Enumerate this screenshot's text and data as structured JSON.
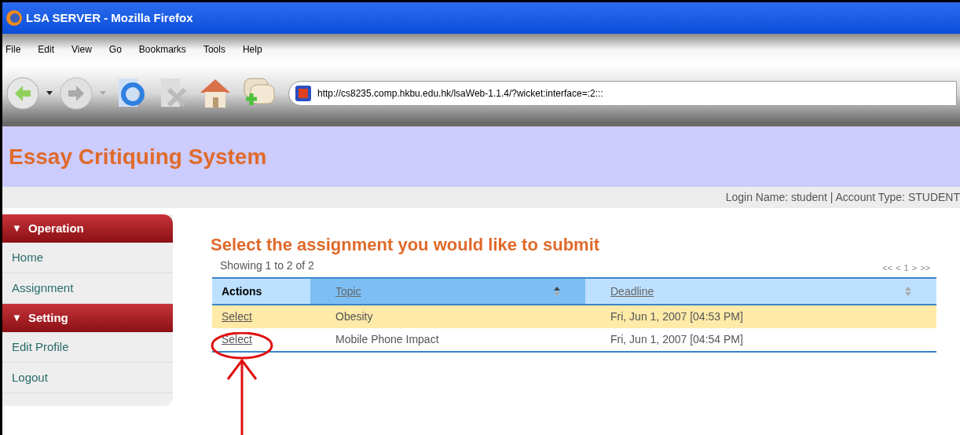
{
  "window": {
    "title": "LSA SERVER - Mozilla Firefox"
  },
  "menu": [
    "File",
    "Edit",
    "View",
    "Go",
    "Bookmarks",
    "Tools",
    "Help"
  ],
  "address": {
    "value": "http://cs8235.comp.hkbu.edu.hk/lsaWeb-1.1.4/?wicket:interface=:2:::"
  },
  "site": {
    "title": "Essay Critiquing System",
    "login_info": "Login Name: student | Account Type: STUDENT"
  },
  "sidebar": [
    {
      "toggle": "▼",
      "heading": "Operation",
      "items": [
        "Home",
        "Assignment"
      ]
    },
    {
      "toggle": "▼",
      "heading": "Setting",
      "items": [
        "Edit Profile",
        "Logout"
      ]
    }
  ],
  "main": {
    "heading": "Select the assignment you would like to submit",
    "showing": "Showing 1 to 2 of 2",
    "pager": [
      "<<",
      "<",
      "1",
      ">",
      ">>"
    ],
    "table": {
      "columns": [
        {
          "label": "Actions",
          "sortable": false,
          "sorted": false
        },
        {
          "label": "Topic",
          "sortable": true,
          "sorted": true
        },
        {
          "label": "Deadline",
          "sortable": true,
          "sorted": false
        }
      ],
      "rows": [
        {
          "action": "Select",
          "topic": "Obesity",
          "deadline": "Fri, Jun 1, 2007 [04:53 PM]",
          "highlighted": true,
          "annotated": false
        },
        {
          "action": "Select",
          "topic": "Mobile Phone Impact",
          "deadline": "Fri, Jun 1, 2007 [04:54 PM]",
          "highlighted": false,
          "annotated": true
        }
      ]
    }
  }
}
